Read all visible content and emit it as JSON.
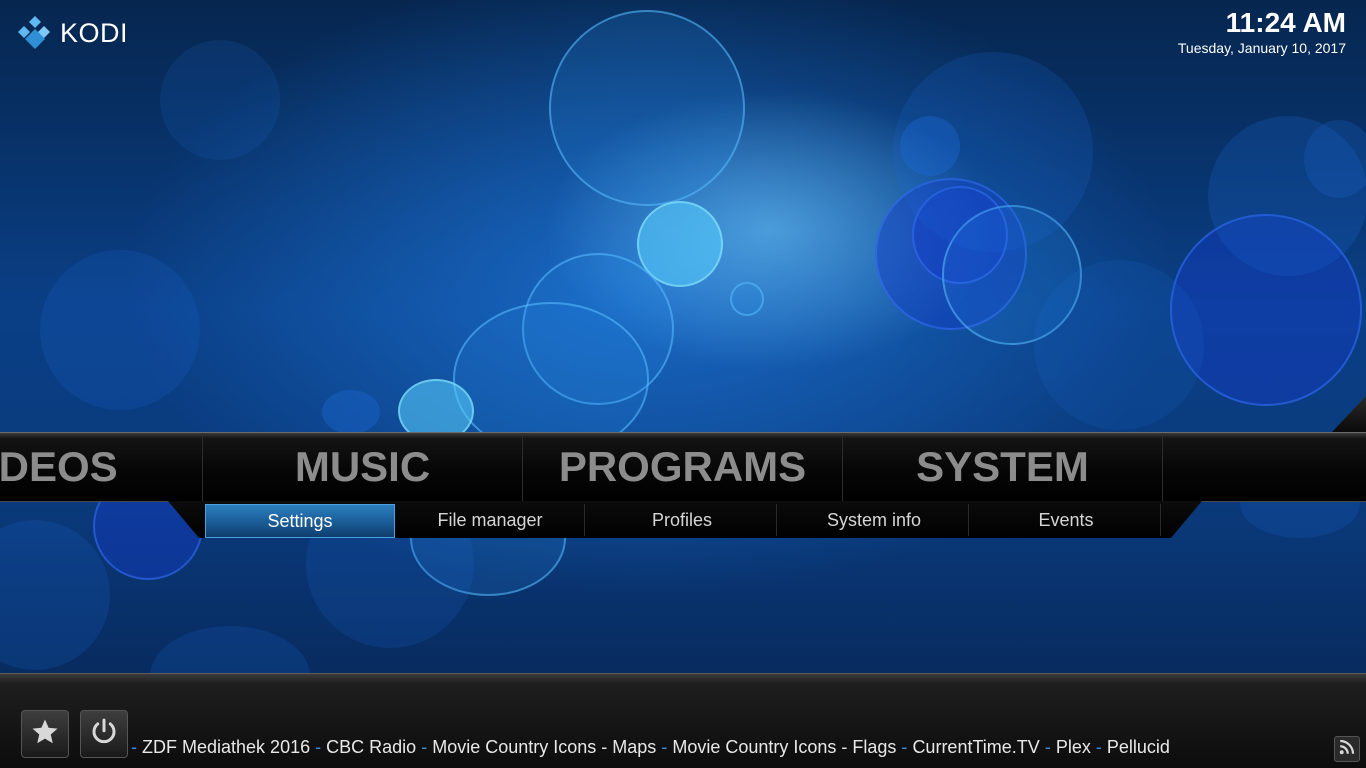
{
  "app": {
    "name": "KODI"
  },
  "clock": {
    "time": "11:24 AM",
    "date": "Tuesday, January 10, 2017"
  },
  "main_menu": {
    "items": [
      {
        "label": "VIDEOS",
        "visible_text": "IDEOS"
      },
      {
        "label": "MUSIC"
      },
      {
        "label": "PROGRAMS"
      },
      {
        "label": "SYSTEM"
      }
    ],
    "selected": "SYSTEM"
  },
  "submenu": {
    "items": [
      {
        "label": "Settings",
        "active": true
      },
      {
        "label": "File manager",
        "active": false
      },
      {
        "label": "Profiles",
        "active": false
      },
      {
        "label": "System info",
        "active": false
      },
      {
        "label": "Events",
        "active": false
      }
    ]
  },
  "bottom_bar": {
    "favourites_icon": "star-icon",
    "power_icon": "power-icon",
    "rss_icon": "rss-icon",
    "ticker_separator": "-",
    "ticker_items": [
      "ZDF Mediathek 2016",
      "CBC Radio",
      "Movie Country Icons - Maps",
      "Movie Country Icons - Flags",
      "CurrentTime.TV",
      "Plex",
      "Pellucid"
    ]
  },
  "colors": {
    "accent": "#2c7fbf",
    "separator": "#3a8ad8",
    "menu_text": "#8c8c8c"
  }
}
